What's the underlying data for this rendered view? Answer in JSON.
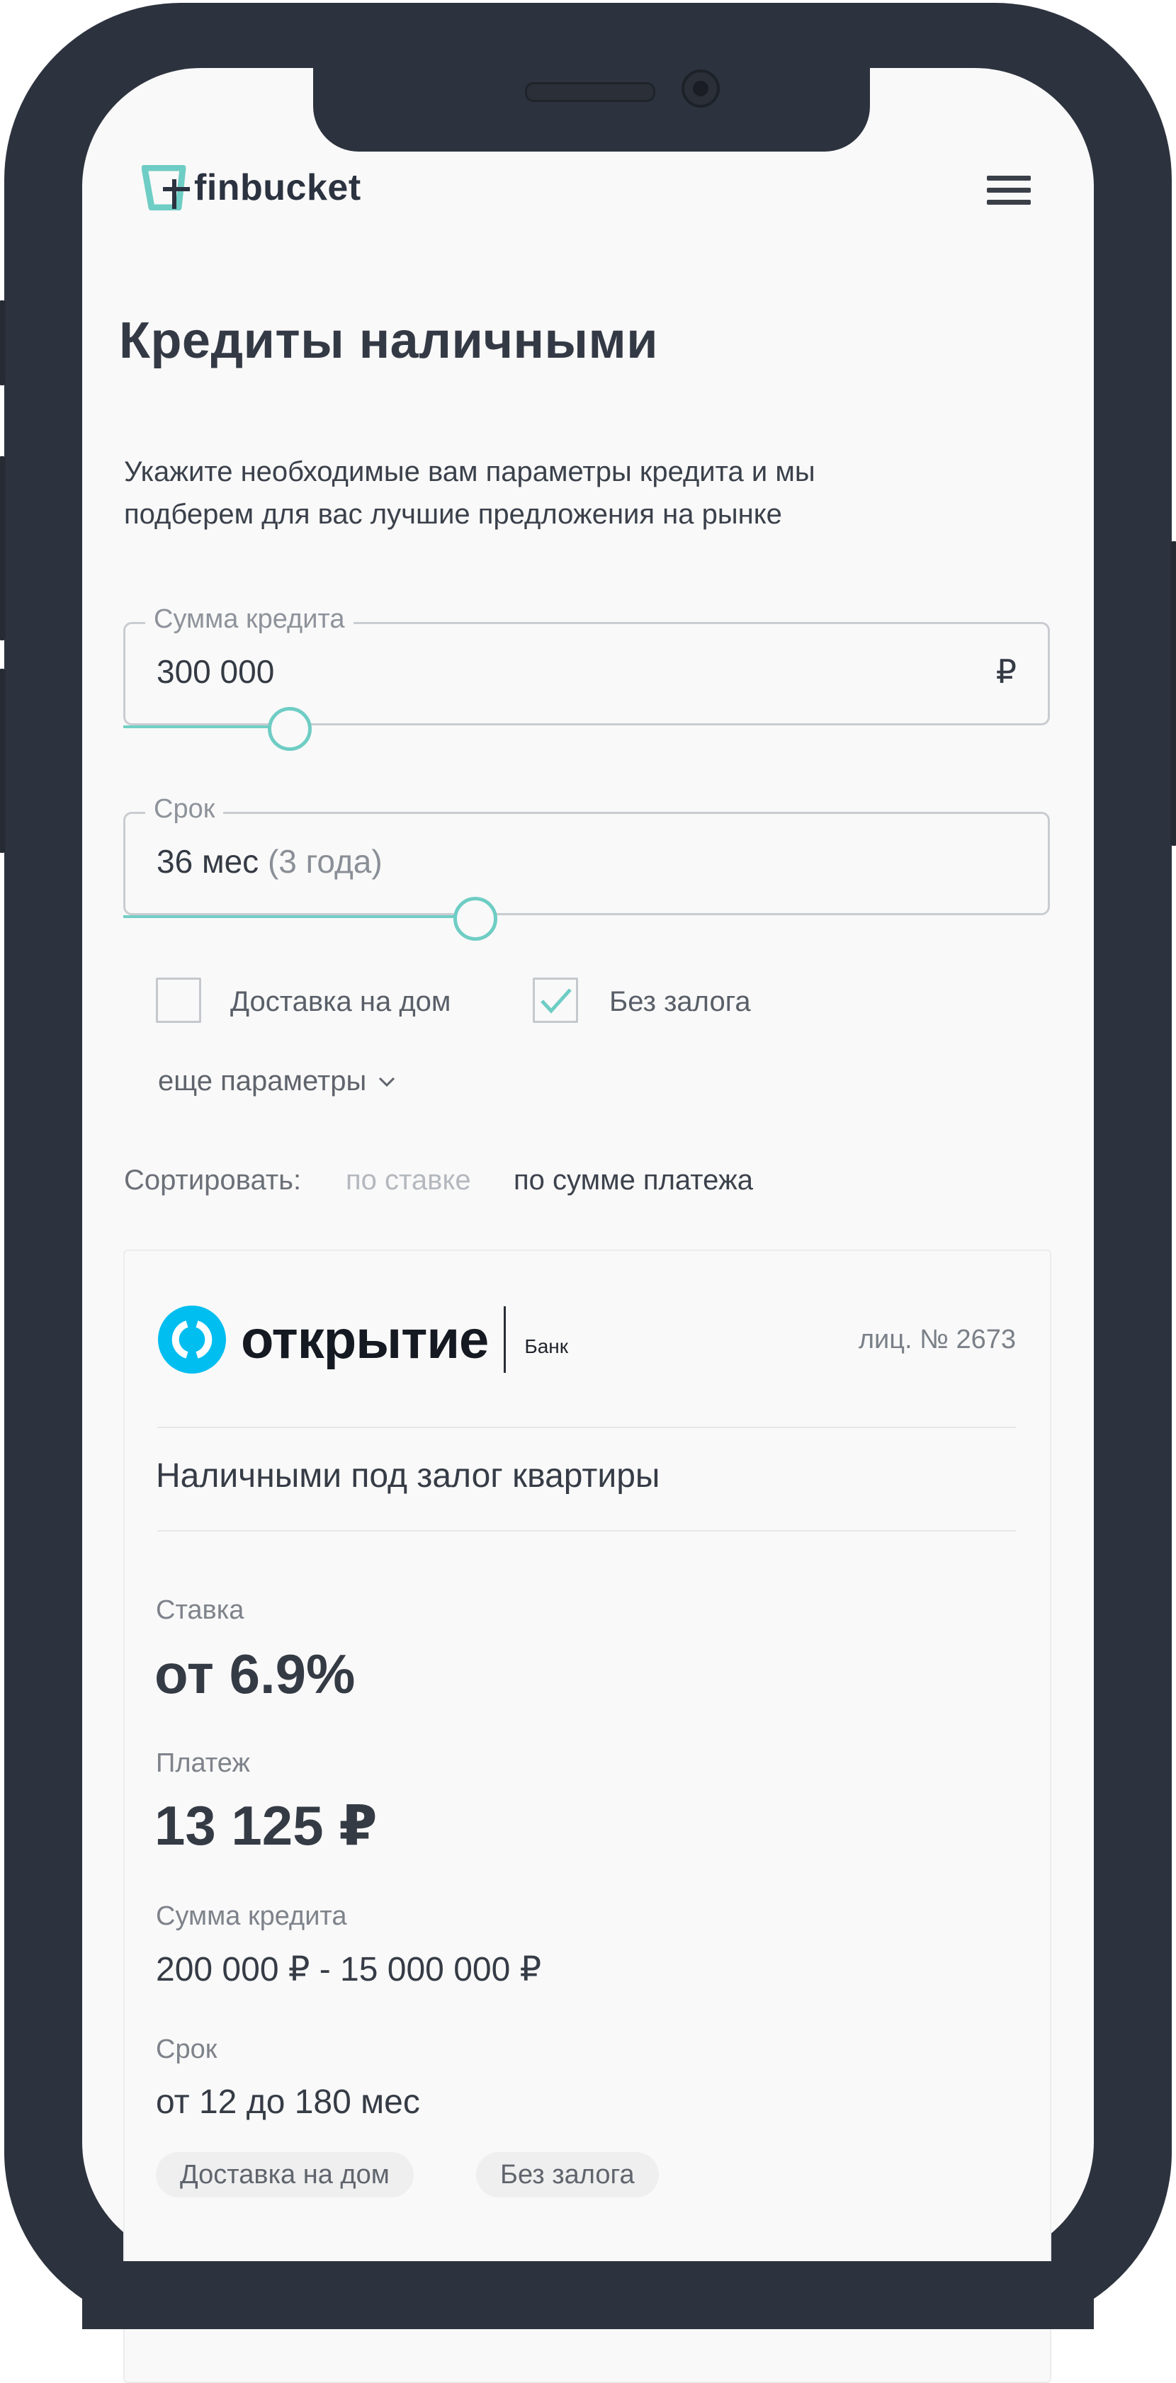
{
  "header": {
    "logo_text": "finbucket",
    "menu_icon": "hamburger-menu-icon"
  },
  "page": {
    "title": "Кредиты наличными",
    "subtitle_line1": "Укажите необходимые вам параметры кредита и мы",
    "subtitle_line2": "подберем для вас лучшие предложения на рынке"
  },
  "form": {
    "amount": {
      "label": "Сумма кредита",
      "value": "300 000",
      "unit": "₽",
      "slider_fraction": 0.18
    },
    "term": {
      "label": "Срок",
      "value": "36 мес",
      "value_hint": "(3 года)",
      "slider_fraction": 0.38
    },
    "checkboxes": [
      {
        "label": "Доставка на дом",
        "checked": false
      },
      {
        "label": "Без залога",
        "checked": true
      }
    ],
    "more_params": "еще параметры"
  },
  "sort": {
    "label": "Сортировать:",
    "options": [
      "по ставке",
      "по сумме платежа"
    ],
    "active_index": 1
  },
  "offer": {
    "bank_name": "открытие",
    "bank_word": "Банк",
    "license": "лиц. № 2673",
    "title": "Наличными под залог квартиры",
    "rate_label": "Ставка",
    "rate_value": "от 6.9%",
    "payment_label": "Платеж",
    "payment_value": "13 125 ₽",
    "amount_label": "Сумма кредита",
    "amount_value": "200 000 ₽ - 15 000 000 ₽",
    "term_label": "Срок",
    "term_value": "от 12 до 180 мес",
    "tags": [
      "Доставка на дом",
      "Без залога"
    ]
  },
  "colors": {
    "accent": "#6ECDC4",
    "bank_blue": "#00BEF0",
    "frame": "#2D333E",
    "screen_bg": "#F9F9F9"
  }
}
